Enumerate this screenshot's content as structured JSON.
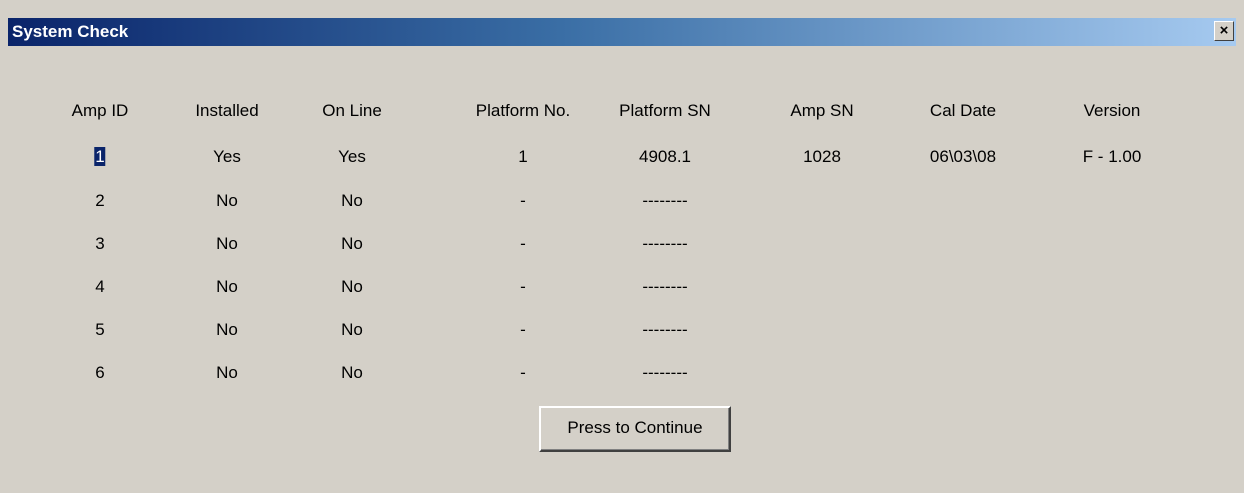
{
  "window": {
    "title": "System Check",
    "close_label": "×"
  },
  "table": {
    "headers": [
      "Amp ID",
      "Installed",
      "On Line",
      "Platform No.",
      "Platform SN",
      "Amp SN",
      "Cal Date",
      "Version"
    ],
    "rows": [
      [
        "1",
        "Yes",
        "Yes",
        "1",
        "4908.1",
        "1028",
        "06\\03\\08",
        "F - 1.00"
      ],
      [
        "2",
        "No",
        "No",
        "-",
        "--------",
        "",
        "",
        ""
      ],
      [
        "3",
        "No",
        "No",
        "-",
        "--------",
        "",
        "",
        ""
      ],
      [
        "4",
        "No",
        "No",
        "-",
        "--------",
        "",
        "",
        ""
      ],
      [
        "5",
        "No",
        "No",
        "-",
        "--------",
        "",
        "",
        ""
      ],
      [
        "6",
        "No",
        "No",
        "-",
        "--------",
        "",
        "",
        ""
      ]
    ]
  },
  "continue_button": {
    "label": "Press to Continue"
  },
  "colors": {
    "face": "#d4d0c8",
    "title_start": "#0a246a",
    "title_end": "#a6caf0",
    "selection": "#0a246a"
  }
}
